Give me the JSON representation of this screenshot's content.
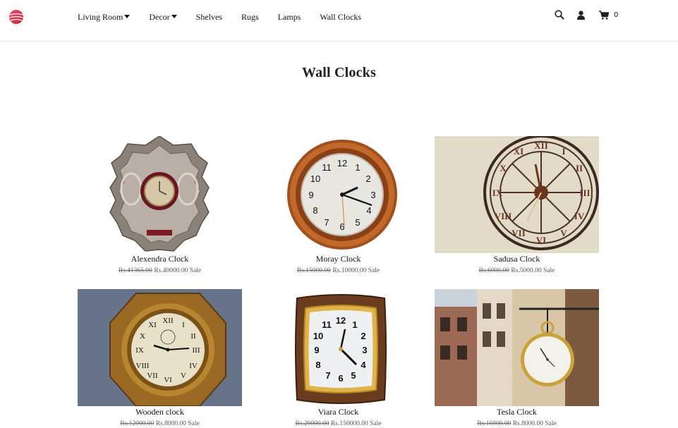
{
  "nav": {
    "items": [
      {
        "label": "Living Room",
        "dropdown": true
      },
      {
        "label": "Decor",
        "dropdown": true
      },
      {
        "label": "Shelves",
        "dropdown": false
      },
      {
        "label": "Rugs",
        "dropdown": false
      },
      {
        "label": "Lamps",
        "dropdown": false
      },
      {
        "label": "Wall Clocks",
        "dropdown": false
      }
    ]
  },
  "header": {
    "cart_count": "0",
    "icons": [
      "search-icon",
      "user-icon",
      "cart-icon"
    ]
  },
  "page": {
    "title": "Wall Clocks"
  },
  "products": [
    {
      "name": "Alexendra Clock",
      "old_price": "Rs.41365.00",
      "price": "Rs.40000.00",
      "badge": "Sale"
    },
    {
      "name": "Moray Clock",
      "old_price": "Rs.15000.00",
      "price": "Rs.10000.00",
      "badge": "Sale"
    },
    {
      "name": "Sadusa Clock",
      "old_price": "Rs.6000.00",
      "price": "Rs.5000.00",
      "badge": "Sale"
    },
    {
      "name": "Wooden clock",
      "old_price": "Rs.12000.00",
      "price": "Rs.8000.00",
      "badge": "Sale"
    },
    {
      "name": "Viara Clock",
      "old_price": "Rs.20000.00",
      "price": "Rs.150000.00",
      "badge": "Sale"
    },
    {
      "name": "Tesla Clock",
      "old_price": "Rs.16000.00",
      "price": "Rs.8000.00",
      "badge": "Sale"
    }
  ],
  "colors": {
    "accent": "#e8344a",
    "text": "#222222",
    "border": "#e6e6e6"
  }
}
